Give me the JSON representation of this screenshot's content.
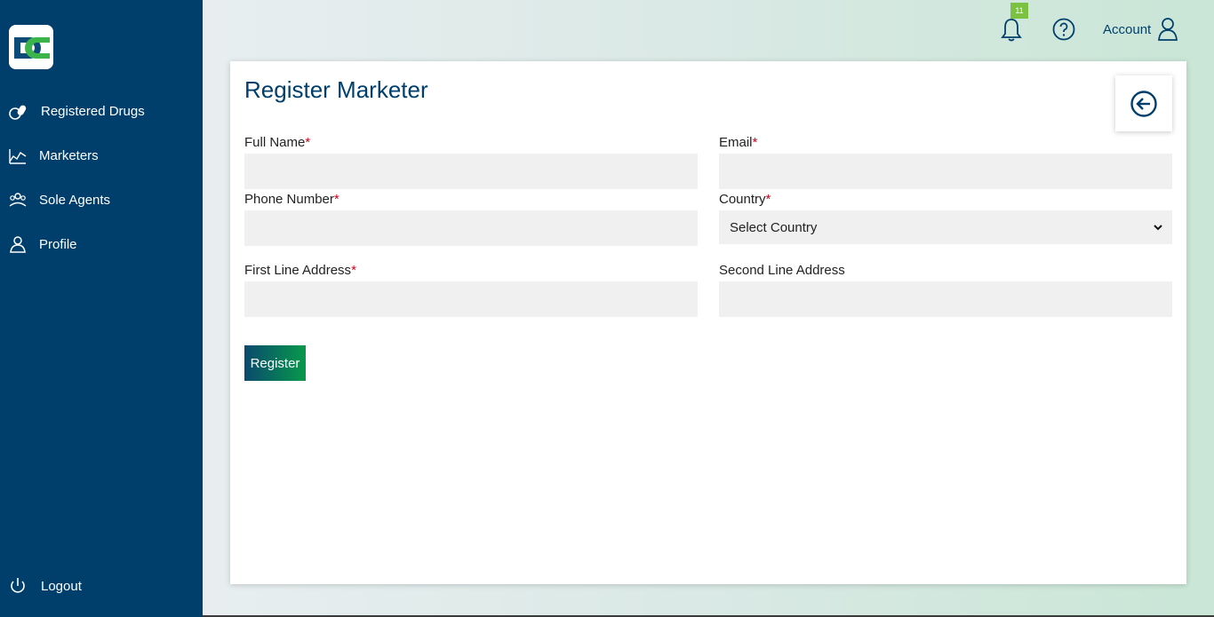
{
  "sidebar": {
    "items": [
      {
        "label": "Registered Drugs",
        "icon": "pills-icon"
      },
      {
        "label": "Marketers",
        "icon": "marketers-icon"
      },
      {
        "label": "Sole Agents",
        "icon": "agents-icon"
      },
      {
        "label": "Profile",
        "icon": "user-icon"
      }
    ],
    "logout": {
      "label": "Logout",
      "icon": "power-icon"
    }
  },
  "header": {
    "notification_count": "11",
    "account_label": "Account"
  },
  "page": {
    "title": "Register Marketer"
  },
  "form": {
    "required_mark": "*",
    "full_name": {
      "label": "Full Name",
      "value": ""
    },
    "email": {
      "label": "Email",
      "value": ""
    },
    "phone": {
      "label": "Phone Number",
      "value": ""
    },
    "country": {
      "label": "Country",
      "selected": "Select Country"
    },
    "address1": {
      "label": "First Line Address",
      "value": ""
    },
    "address2": {
      "label": "Second Line Address",
      "value": ""
    },
    "submit_label": "Register"
  },
  "colors": {
    "sidebar": "#003f6b",
    "accent": "#003f6b",
    "required": "#d0021b",
    "badge": "#7cc242",
    "button_gradient_start": "#0a4a6e",
    "button_gradient_end": "#07994b"
  }
}
